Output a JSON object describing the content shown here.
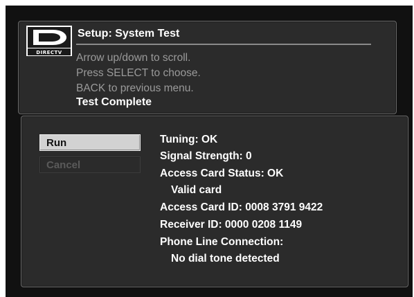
{
  "header": {
    "brand": "DIRECTV",
    "title": "Setup: System Test",
    "instructions": [
      "Arrow up/down to scroll.",
      "Press SELECT to choose.",
      "BACK to previous menu."
    ],
    "status": "Test Complete"
  },
  "buttons": {
    "run_label": "Run",
    "cancel_label": "Cancel",
    "selected": "Run",
    "cancel_enabled": false
  },
  "results": [
    "Tuning:  OK",
    "Signal Strength:  0",
    "Access Card Status:  OK",
    "Valid card",
    "Access Card ID:  0008 3791 9422",
    "Receiver ID: 0000 0208 1149",
    "Phone Line Connection:",
    "No dial tone detected"
  ],
  "colors": {
    "background": "#111111",
    "panel": "#2b2b2b",
    "panel_border": "#6b6b6b",
    "text_primary": "#ffffff",
    "text_dim": "#9a9a9a",
    "button_selected": "#d2d2d2",
    "button_disabled_text": "#5a5a5a"
  }
}
